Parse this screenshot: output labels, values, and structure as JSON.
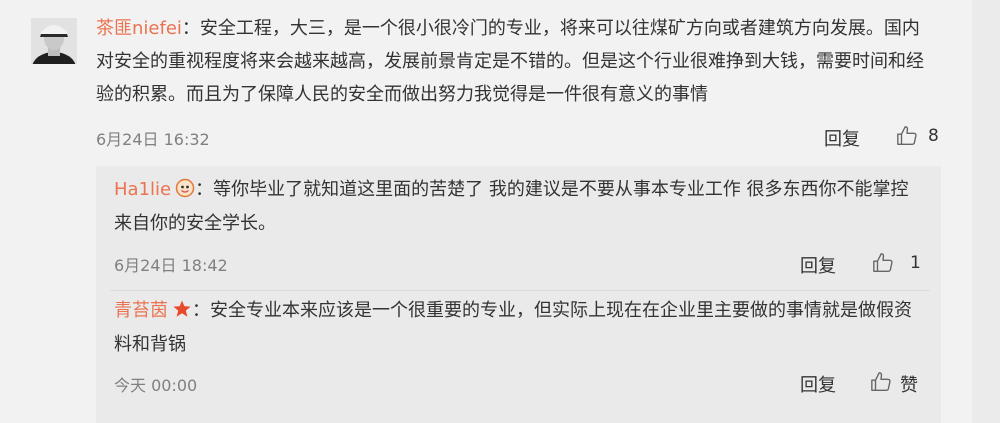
{
  "comment": {
    "username": "茶匪niefei",
    "separator": "：",
    "text": "安全工程，大三，是一个很小很冷门的专业，将来可以往煤矿方向或者建筑方向发展。国内对安全的重视程度将来会越来越高，发展前景肯定是不错的。但是这个行业很难挣到大钱，需要时间和经验的积累。而且为了保障人民的安全而做出努力我觉得是一件很有意义的事情",
    "time": "6月24日 16:32",
    "reply_label": "回复",
    "like_count": "8"
  },
  "replies": [
    {
      "username": "Ha1lie",
      "separator": "：",
      "text": "等你毕业了就知道这里面的苦楚了 我的建议是不要从事本专业工作 很多东西你不能掌控 来自你的安全学长。",
      "time": "6月24日 18:42",
      "reply_label": "回复",
      "like_count": "1"
    },
    {
      "username": "青苔茵",
      "separator": "：",
      "text": "安全专业本来应该是一个很重要的专业，但实际上现在在企业里主要做的事情就是做假资料和背锅",
      "time": "今天 00:00",
      "reply_label": "回复",
      "like_label": "赞"
    }
  ],
  "colors": {
    "username": "#eb7350",
    "badge_star": "#e6492b"
  }
}
